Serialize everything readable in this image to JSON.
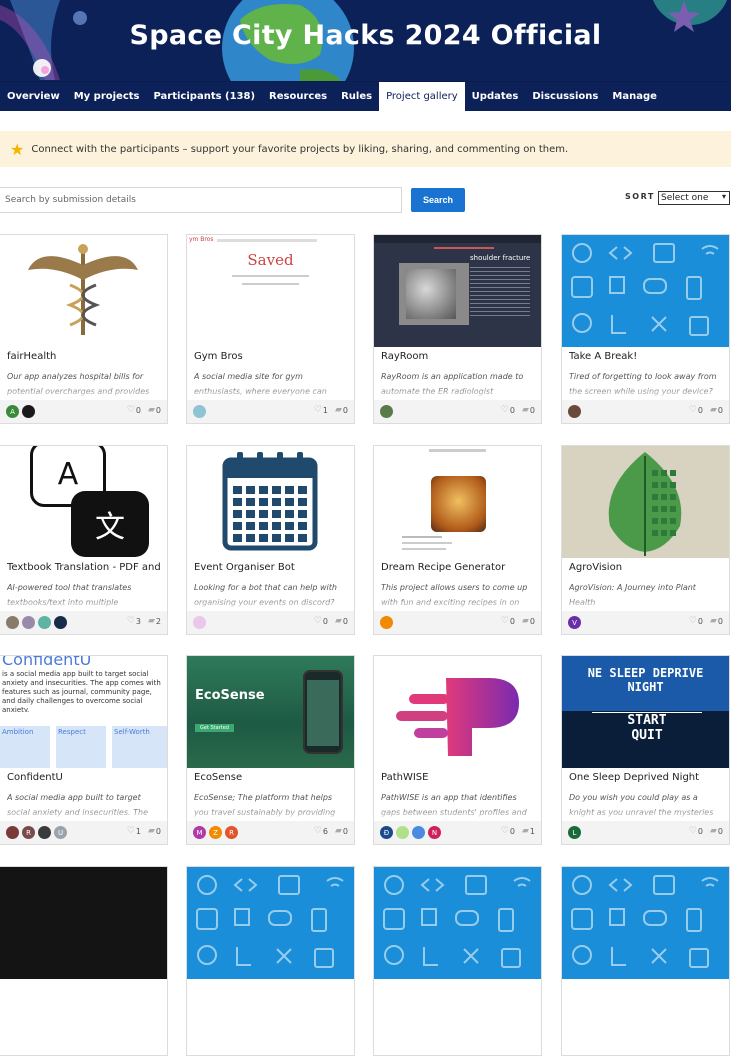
{
  "header": {
    "title": "Space City Hacks 2024 Official"
  },
  "tabs": [
    {
      "label": "Overview",
      "active": false
    },
    {
      "label": "My projects",
      "active": false
    },
    {
      "label": "Participants (138)",
      "active": false
    },
    {
      "label": "Resources",
      "active": false
    },
    {
      "label": "Rules",
      "active": false
    },
    {
      "label": "Project gallery",
      "active": true
    },
    {
      "label": "Updates",
      "active": false
    },
    {
      "label": "Discussions",
      "active": false
    },
    {
      "label": "Manage",
      "active": false
    }
  ],
  "banner": {
    "text": "Connect with the participants – support your favorite projects by liking, sharing, and commenting on them."
  },
  "search": {
    "placeholder": "Search by submission details",
    "button_label": "Search"
  },
  "sort": {
    "label": "SORT",
    "selected": "Select one"
  },
  "thumb_text": {
    "gymbros_logo": "ym Bros",
    "gymbros_saved": "Saved",
    "rayroom_heading": "shoulder fracture",
    "translate_a": "A",
    "translate_wen": "文",
    "confident_title": "ConfidentU",
    "confident_sub": "is a social media app built to target social anxiety and insecurities. The app comes with features such as journal, community page, and daily challenges to overcome social anxiety.",
    "confident_col1": "Ambition",
    "confident_col2": "Respect",
    "confident_col3": "Self-Worth",
    "ecosense_title": "EcoSense",
    "ecosense_btn": "Get Started",
    "sleep_title": "NE SLEEP DEPRIVE",
    "sleep_night": "NIGHT",
    "sleep_start": "START",
    "sleep_quit": "QUIT"
  },
  "projects": [
    {
      "title": "fairHealth",
      "description": "Our app analyzes hospital bills for potential overcharges and provides",
      "likes": "0",
      "comments": "0",
      "avatars": [
        {
          "letter": "A",
          "color": "#3a8a3a"
        },
        {
          "letter": "",
          "color": "#1a1a1a"
        }
      ]
    },
    {
      "title": "Gym Bros",
      "description": "A social media site for gym enthusiasts, where everyone can",
      "likes": "1",
      "comments": "0",
      "avatars": [
        {
          "letter": "",
          "color": "#8fc3d6"
        }
      ]
    },
    {
      "title": "RayRoom",
      "description": "RayRoom is an application made to automate the ER radiologist",
      "likes": "0",
      "comments": "0",
      "avatars": [
        {
          "letter": "",
          "color": "#5a7a4a"
        }
      ]
    },
    {
      "title": "Take A Break!",
      "description": "Tired of forgetting to look away from the screen while using your device?",
      "likes": "0",
      "comments": "0",
      "avatars": [
        {
          "letter": "",
          "color": "#6a4a3a"
        }
      ]
    },
    {
      "title": "Textbook Translation - PDF and",
      "description": "AI-powered tool that translates textbooks/text into multiple",
      "likes": "3",
      "comments": "2",
      "avatars": [
        {
          "letter": "",
          "color": "#8a7a6a"
        },
        {
          "letter": "",
          "color": "#9a8aaa"
        },
        {
          "letter": "",
          "color": "#5fb3a3"
        },
        {
          "letter": "",
          "color": "#1a2a4a"
        }
      ]
    },
    {
      "title": "Event Organiser Bot",
      "description": "Looking for a bot that can help with organising your events on discord?",
      "likes": "0",
      "comments": "0",
      "avatars": [
        {
          "letter": "",
          "color": "#e9c8e9"
        }
      ]
    },
    {
      "title": "Dream Recipe Generator",
      "description": "This project allows users to come up with fun and exciting recipes in on",
      "likes": "0",
      "comments": "0",
      "avatars": [
        {
          "letter": "",
          "color": "#f08a00"
        }
      ]
    },
    {
      "title": "AgroVision",
      "description": "AgroVision: A Journey into Plant Health",
      "likes": "0",
      "comments": "0",
      "avatars": [
        {
          "letter": "V",
          "color": "#6a2fa8"
        }
      ]
    },
    {
      "title": "ConfidentU",
      "description": "A social media app built to target social anxiety and insecurities. The",
      "likes": "1",
      "comments": "0",
      "avatars": [
        {
          "letter": "",
          "color": "#7a3a3a"
        },
        {
          "letter": "R",
          "color": "#7a4a4a"
        },
        {
          "letter": "",
          "color": "#3a3a3a"
        },
        {
          "letter": "U",
          "color": "#9aa3ad"
        }
      ]
    },
    {
      "title": "EcoSense",
      "description": "EcoSense; The platform that helps you travel sustainably by providing",
      "likes": "6",
      "comments": "0",
      "avatars": [
        {
          "letter": "M",
          "color": "#b03aa8"
        },
        {
          "letter": "Z",
          "color": "#f08a00"
        },
        {
          "letter": "R",
          "color": "#e0552a"
        }
      ]
    },
    {
      "title": "PathWISE",
      "description": "PathWISE is an app that identifies gaps between students' profiles and",
      "likes": "0",
      "comments": "1",
      "avatars": [
        {
          "letter": "Đ",
          "color": "#1a4a8a"
        },
        {
          "letter": "",
          "color": "#b0e08a"
        },
        {
          "letter": "",
          "color": "#4a8ae0"
        },
        {
          "letter": "N",
          "color": "#d0205a"
        }
      ]
    },
    {
      "title": "One Sleep Deprived Night",
      "description": "Do you wish you could play as a knight as you unravel the mysteries",
      "likes": "0",
      "comments": "0",
      "avatars": [
        {
          "letter": "L",
          "color": "#1a6a3a"
        }
      ]
    }
  ],
  "colors": {
    "nav_bg": "#0b2158",
    "accent": "#1a73d1",
    "banner_bg": "#fdf3dc",
    "star": "#f5b400"
  }
}
